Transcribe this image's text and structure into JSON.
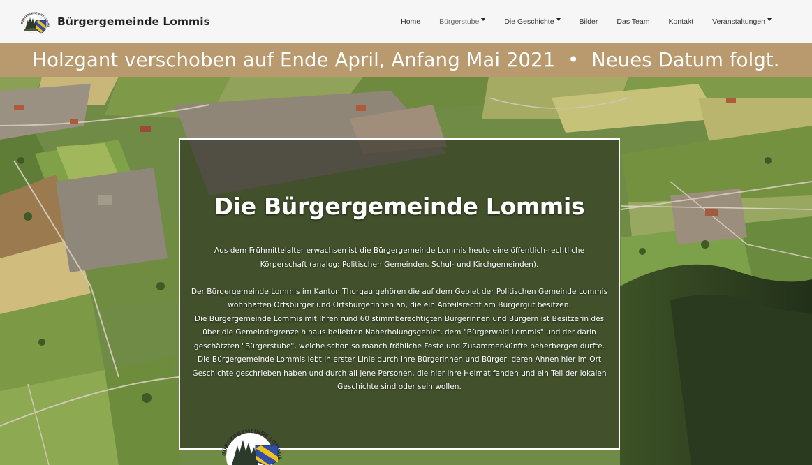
{
  "brand": {
    "name": "Bürgergemeinde Lommis",
    "logo_text": "BÜRGERGEMEINDE LOMMIS"
  },
  "nav": {
    "items": [
      {
        "label": "Home",
        "dropdown": false
      },
      {
        "label": "Bürgerstube",
        "dropdown": true
      },
      {
        "label": "Die Geschichte",
        "dropdown": true
      },
      {
        "label": "Bilder",
        "dropdown": false
      },
      {
        "label": "Das Team",
        "dropdown": false
      },
      {
        "label": "Kontakt",
        "dropdown": false
      },
      {
        "label": "Veranstaltungen",
        "dropdown": true
      }
    ]
  },
  "banner": {
    "text": "Holzgant verschoben auf Ende April, Anfang Mai 2021  •  Neues Datum folgt."
  },
  "content": {
    "title": "Die Bürgergemeinde Lommis",
    "paragraphs": [
      "Aus dem Frühmittelalter erwachsen ist die Bürgergemeinde Lommis heute eine öffentlich-rechtliche Körperschaft (analog: Politischen Gemeinden, Schul- und Kirchgemeinden).",
      "Der Bürgergemeinde Lommis im Kanton Thurgau gehören die auf dem Gebiet der Politischen Gemeinde Lommis wohnhaften Ortsbürger und Ortsbürgerinnen an, die ein Anteilsrecht am Bürgergut besitzen.",
      "Die Bürgergemeinde Lommis mit Ihren rund 60 stimmberechtigten Bürgerinnen und Bürgern ist Besitzerin des über die Gemeindegrenze hinaus beliebten Naherholungsgebiet, dem \"Bürgerwald Lommis\" und der darin geschätzten \"Bürgerstube\", welche schon so manch fröhliche Feste und Zusammenkünfte beherbergen durfte.",
      "Die Bürgergemeinde Lommis lebt in erster Linie durch Ihre Bürgerinnen und Bürger, deren Ahnen hier im Ort Geschichte geschrieben haben und durch all jene Personen, die hier ihre Heimat fanden und ein Teil der lokalen Geschichte sind oder sein wollen."
    ]
  },
  "colors": {
    "banner": "#b89a6e",
    "navbar": "#f6f6f6",
    "crest_blue": "#2f4fa8",
    "crest_yellow": "#f2c21b"
  },
  "icons": {
    "brand_logo": "lommis-crest-icon",
    "caret": "caret-down-icon"
  }
}
